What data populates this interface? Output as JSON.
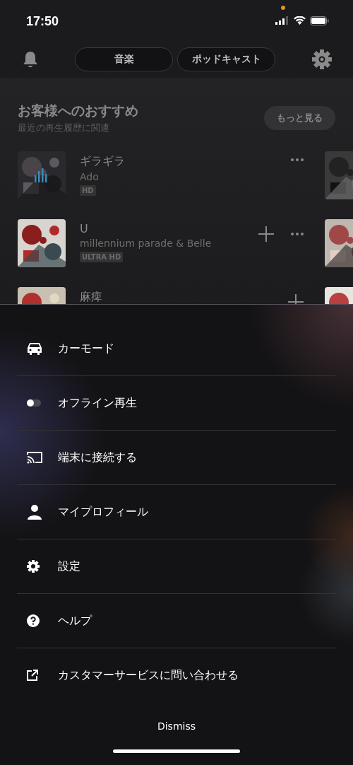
{
  "status_bar": {
    "time": "17:50"
  },
  "header": {
    "tabs": [
      {
        "label": "音楽",
        "selected": false
      },
      {
        "label": "ポッドキャスト",
        "selected": false
      }
    ]
  },
  "recommendations": {
    "title": "お客様へのおすすめ",
    "subtitle": "最近の再生履歴に関連",
    "more_button": "もっと見る",
    "tracks": [
      {
        "title": "ギラギラ",
        "artist": "Ado",
        "badge": "HD",
        "playing": true,
        "addable": false
      },
      {
        "title": "U",
        "artist": "millennium parade & Belle",
        "badge": "ULTRA HD",
        "playing": false,
        "addable": true
      },
      {
        "title": "麻痺",
        "playing": false,
        "addable": true
      }
    ]
  },
  "menu": {
    "items": [
      {
        "label": "カーモード",
        "kind": "link"
      },
      {
        "label": "オフライン再生",
        "kind": "toggle",
        "on": false
      },
      {
        "label": "端末に接続する",
        "kind": "link"
      },
      {
        "label": "マイプロフィール",
        "kind": "link"
      },
      {
        "label": "設定",
        "kind": "link"
      },
      {
        "label": "ヘルプ",
        "kind": "link"
      },
      {
        "label": "カスタマーサービスに問い合わせる",
        "kind": "link"
      }
    ],
    "dismiss": "Dismiss"
  }
}
